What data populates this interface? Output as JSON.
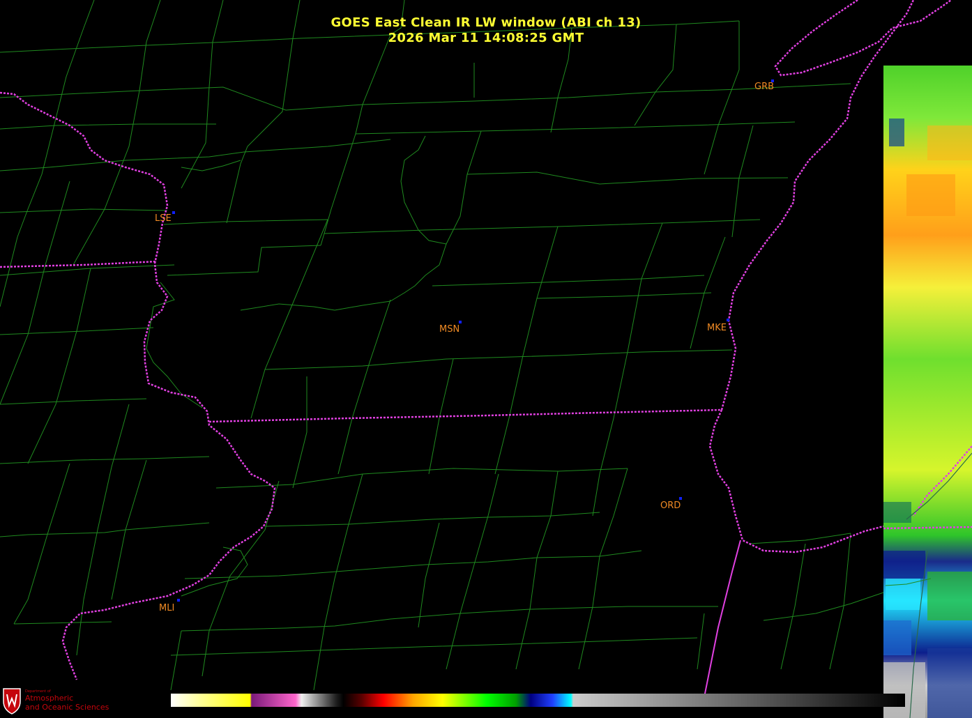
{
  "title": {
    "line1": "GOES East Clean IR LW window (ABI ch 13)",
    "line2": "2026 Mar 11  14:08:25 GMT"
  },
  "colors": {
    "title": "#ffff33",
    "station_label": "#f08a24",
    "station_dot": "#1020ff",
    "county_lines": "#1f8a1f",
    "state_lines": "#e040e0",
    "background": "#000000"
  },
  "stations": [
    {
      "id": "GRB"
    },
    {
      "id": "LSE"
    },
    {
      "id": "MSN"
    },
    {
      "id": "MKE"
    },
    {
      "id": "ORD"
    },
    {
      "id": "MLI"
    }
  ],
  "colorbar": {
    "icon": "ir-temperature-colorbar"
  },
  "logo": {
    "line1": "Department of",
    "line2": "Atmospheric",
    "line3": "and Oceanic Sciences",
    "icon": "uw-crest-icon"
  }
}
